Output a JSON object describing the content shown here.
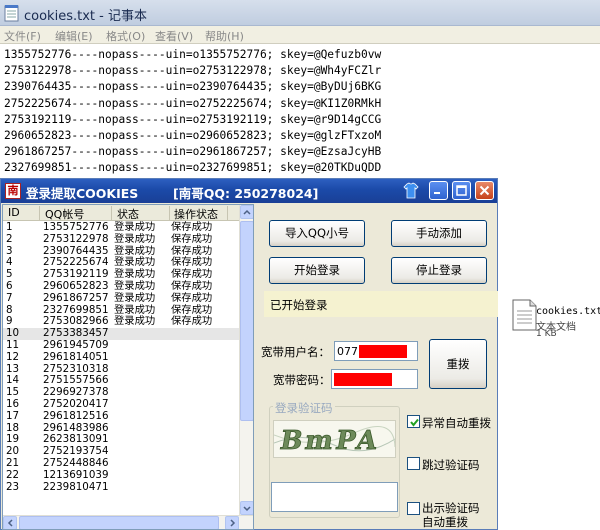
{
  "notepad": {
    "title": "cookies.txt - 记事本",
    "menu": [
      "文件(F)",
      "编辑(E)",
      "格式(O)",
      "查看(V)",
      "帮助(H)"
    ],
    "lines": [
      "1355752776----nopass----uin=o1355752776; skey=@Qefuzb0vw",
      "2753122978----nopass----uin=o2753122978; skey=@Wh4yFCZlr",
      "2390764435----nopass----uin=o2390764435; skey=@ByDUj6BKG",
      "2752225674----nopass----uin=o2752225674; skey=@KI1Z0RMkH",
      "2753192119----nopass----uin=o2753192119; skey=@r9D14gCCG",
      "2960652823----nopass----uin=o2960652823; skey=@glzFTxzoM",
      "2961867257----nopass----uin=o2961867257; skey=@EzsaJcyHB",
      "2327699851----nopass----uin=o2327699851; skey=@20TKDuQDD",
      "2753082966----nopass----uin=o2753082966; skey=@nIZnS7qk2"
    ]
  },
  "desktop_file": {
    "name": "cookies.txt",
    "type": "文本文档",
    "size": "1 KB"
  },
  "dialog": {
    "title": "登录提取COOKIES",
    "qq_tag": "[南哥QQ: 250278024]",
    "table": {
      "columns": [
        "ID",
        "QQ帐号",
        "状态",
        "操作状态"
      ],
      "rows": [
        {
          "id": "1",
          "qq": "1355752776",
          "status": "登录成功",
          "op": "保存成功"
        },
        {
          "id": "2",
          "qq": "2753122978",
          "status": "登录成功",
          "op": "保存成功"
        },
        {
          "id": "3",
          "qq": "2390764435",
          "status": "登录成功",
          "op": "保存成功"
        },
        {
          "id": "4",
          "qq": "2752225674",
          "status": "登录成功",
          "op": "保存成功"
        },
        {
          "id": "5",
          "qq": "2753192119",
          "status": "登录成功",
          "op": "保存成功"
        },
        {
          "id": "6",
          "qq": "2960652823",
          "status": "登录成功",
          "op": "保存成功"
        },
        {
          "id": "7",
          "qq": "2961867257",
          "status": "登录成功",
          "op": "保存成功"
        },
        {
          "id": "8",
          "qq": "2327699851",
          "status": "登录成功",
          "op": "保存成功"
        },
        {
          "id": "9",
          "qq": "2753082966",
          "status": "登录成功",
          "op": "保存成功"
        },
        {
          "id": "10",
          "qq": "2753383457",
          "status": "",
          "op": ""
        },
        {
          "id": "11",
          "qq": "2961945709",
          "status": "",
          "op": ""
        },
        {
          "id": "12",
          "qq": "2961814051",
          "status": "",
          "op": ""
        },
        {
          "id": "13",
          "qq": "2752310318",
          "status": "",
          "op": ""
        },
        {
          "id": "14",
          "qq": "2751557566",
          "status": "",
          "op": ""
        },
        {
          "id": "15",
          "qq": "2296927378",
          "status": "",
          "op": ""
        },
        {
          "id": "16",
          "qq": "2752020417",
          "status": "",
          "op": ""
        },
        {
          "id": "17",
          "qq": "2961812516",
          "status": "",
          "op": ""
        },
        {
          "id": "18",
          "qq": "2961483986",
          "status": "",
          "op": ""
        },
        {
          "id": "19",
          "qq": "2623813091",
          "status": "",
          "op": ""
        },
        {
          "id": "20",
          "qq": "2752193754",
          "status": "",
          "op": ""
        },
        {
          "id": "21",
          "qq": "2752448846",
          "status": "",
          "op": ""
        },
        {
          "id": "22",
          "qq": "1213691039",
          "status": "",
          "op": ""
        },
        {
          "id": "23",
          "qq": "2239810471",
          "status": "",
          "op": ""
        }
      ],
      "selected_row_index": 9
    },
    "buttons": {
      "import": "导入QQ小号",
      "manual_add": "手动添加",
      "start": "开始登录",
      "stop": "停止登录",
      "redial": "重拨"
    },
    "status_text": "已开始登录",
    "broadband_user_label": "宽带用户名：",
    "broadband_user_value": "077",
    "broadband_pass_label": "宽带密码：",
    "captcha_group_label": "登录验证码",
    "captcha_text": "BmPA",
    "checkboxes": {
      "auto_redial": {
        "label": "异常自动重拨",
        "checked": true
      },
      "skip_captcha": {
        "label": "跳过验证码",
        "checked": false
      },
      "show_captcha": {
        "label": "出示验证码",
        "label2": "自动重拨",
        "checked": false
      }
    },
    "colors": {
      "titlebar": "#1f4fb0",
      "status_bg": "#f5f2d0",
      "redaction": "#ff0000"
    }
  }
}
